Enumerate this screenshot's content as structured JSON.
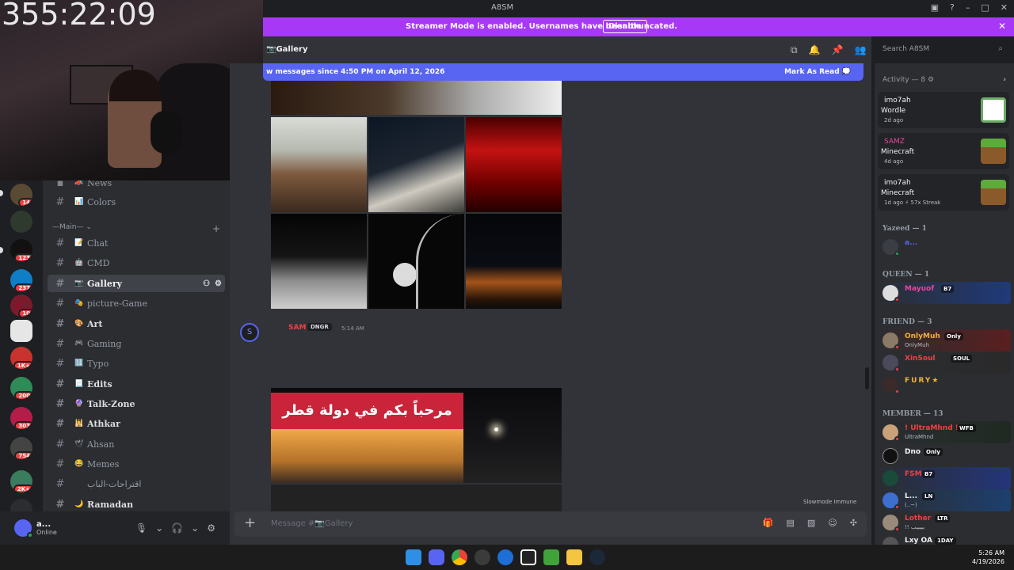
{
  "window": {
    "title": "A8SM"
  },
  "banner": {
    "message": "Streamer Mode is enabled. Usernames have been truncated.",
    "button": "Disable"
  },
  "stream_overlay": {
    "timer": "355:22:09"
  },
  "server_badges": [
    "14",
    "123",
    "237",
    "10",
    "1K+",
    "200",
    "303",
    "754",
    "2K+"
  ],
  "channels": {
    "category": "Main",
    "items": [
      {
        "emoji": "📣",
        "label": "News"
      },
      {
        "emoji": "📊",
        "label": "Colors"
      },
      {
        "emoji": "📝",
        "label": "Chat"
      },
      {
        "emoji": "🤖",
        "label": "CMD"
      },
      {
        "emoji": "📷",
        "label": "Gallery"
      },
      {
        "emoji": "🎭",
        "label": "picture-Game"
      },
      {
        "emoji": "🎨",
        "label": "Art"
      },
      {
        "emoji": "🎮",
        "label": "Gaming"
      },
      {
        "emoji": "🔢",
        "label": "Typo"
      },
      {
        "emoji": "📃",
        "label": "Edits"
      },
      {
        "emoji": "🔮",
        "label": "Talk-Zone"
      },
      {
        "emoji": "🕌",
        "label": "Athkar"
      },
      {
        "emoji": "🕊",
        "label": "Ahsan"
      },
      {
        "emoji": "😂",
        "label": "Memes"
      },
      {
        "emoji": "",
        "label": "اقتراحات-الباب"
      },
      {
        "emoji": "🌙",
        "label": "Ramadan"
      }
    ]
  },
  "user": {
    "name": "a...",
    "status": "Online"
  },
  "header": {
    "channel": "📷Gallery",
    "search_placeholder": "Search A8SM"
  },
  "new_messages": {
    "text": "w messages since 4:50 PM on April 12, 2026",
    "action": "Mark As Read"
  },
  "message": {
    "author": "SAM",
    "tag": "DNGR",
    "time": "5:14 AM",
    "sign_text": "مرحباً بكم في دولة قطر"
  },
  "slowmode": "Slowmode Immune",
  "composer": {
    "placeholder": "Message #📷Gallery"
  },
  "members": {
    "activity_header": "Activity — 8",
    "activities": [
      {
        "user": "imo7ah",
        "game": "Wordle",
        "when": "2d ago"
      },
      {
        "user": "SAMZ",
        "game": "Minecraft",
        "when": "4d ago"
      },
      {
        "user": "imo7ah",
        "game": "Minecraft",
        "when": "1d ago  ⚡ 57x Streak"
      }
    ],
    "groups": [
      {
        "title": "Yazeed — 1"
      },
      {
        "title": "QUEEN — 1"
      },
      {
        "title": "FRIEND — 3"
      },
      {
        "title": "MEMBER — 13"
      }
    ],
    "people": [
      {
        "name": "a...",
        "tag": "",
        "sub": "",
        "color": "#949ba4"
      },
      {
        "name": "Mayuof",
        "tag": "B7",
        "sub": "",
        "color": "#eb459e"
      },
      {
        "name": "OnlyMuh",
        "tag": "Only",
        "sub": "OnlyMuh",
        "color": "#f0b232"
      },
      {
        "name": "XinSoul",
        "tag": "SOUL",
        "sub": "",
        "color": "#f23f43"
      },
      {
        "name": "FURY★",
        "tag": "",
        "sub": "",
        "color": "#f0b232"
      },
      {
        "name": "! UltraMhnd !",
        "tag": "WFB",
        "sub": "UltraMhnd",
        "color": "#f23f43"
      },
      {
        "name": "Dno",
        "tag": "Only",
        "sub": "",
        "color": "#f2f3f5"
      },
      {
        "name": "FSM",
        "tag": "B7",
        "sub": "",
        "color": "#f23f43"
      },
      {
        "name": "L...",
        "tag": "LN",
        "sub": "(..~)",
        "color": "#f2f3f5"
      },
      {
        "name": "Lother",
        "tag": "LTR",
        "sub": "!! يبيبيب",
        "color": "#f23f43"
      },
      {
        "name": "Lxy OA",
        "tag": "1DAY",
        "sub": "",
        "color": "#f2f3f5"
      }
    ]
  },
  "taskbar": {
    "time": "5:26 AM",
    "date": "4/19/2026"
  },
  "colors": {
    "accent": "#5865f2",
    "banner": "#a638f6",
    "danger": "#f23f43"
  }
}
